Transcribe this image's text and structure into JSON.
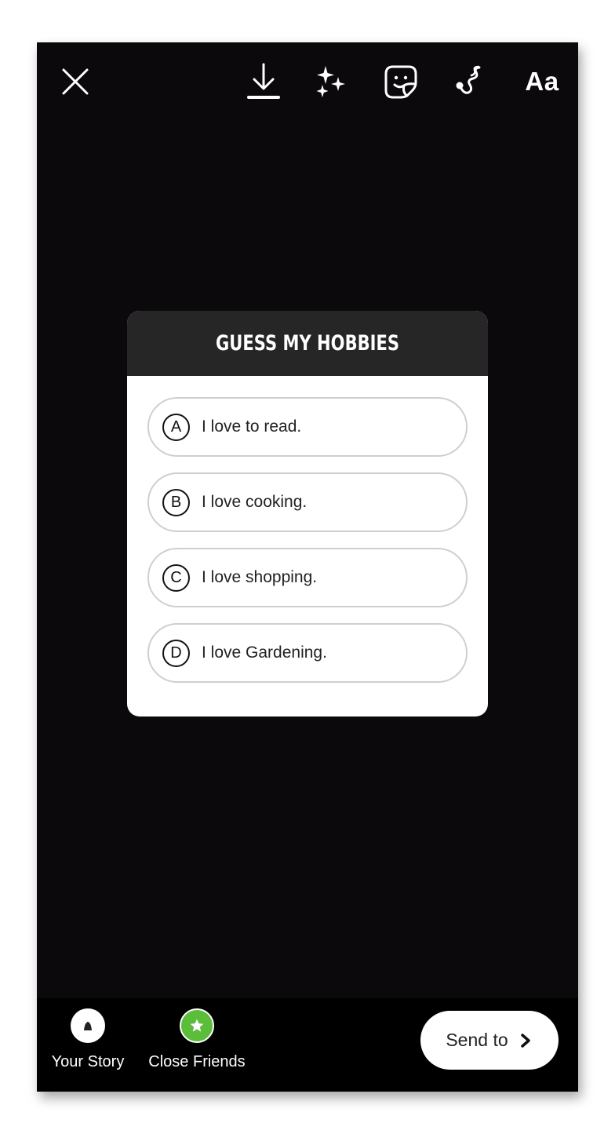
{
  "toolbar": {
    "close_icon": "close-icon",
    "download_icon": "download-icon",
    "effects_icon": "sparkles-icon",
    "sticker_icon": "sticker-icon",
    "draw_icon": "draw-icon",
    "text_label": "Aa"
  },
  "quiz": {
    "title": "GUESS MY HOBBIES",
    "options": [
      {
        "letter": "A",
        "text": "I love to read."
      },
      {
        "letter": "B",
        "text": "I love cooking."
      },
      {
        "letter": "C",
        "text": "I love shopping."
      },
      {
        "letter": "D",
        "text": "I love Gardening."
      }
    ]
  },
  "bottom": {
    "your_story_label": "Your Story",
    "close_friends_label": "Close Friends",
    "send_label": "Send to",
    "close_friends_color": "#5cbd3b"
  }
}
